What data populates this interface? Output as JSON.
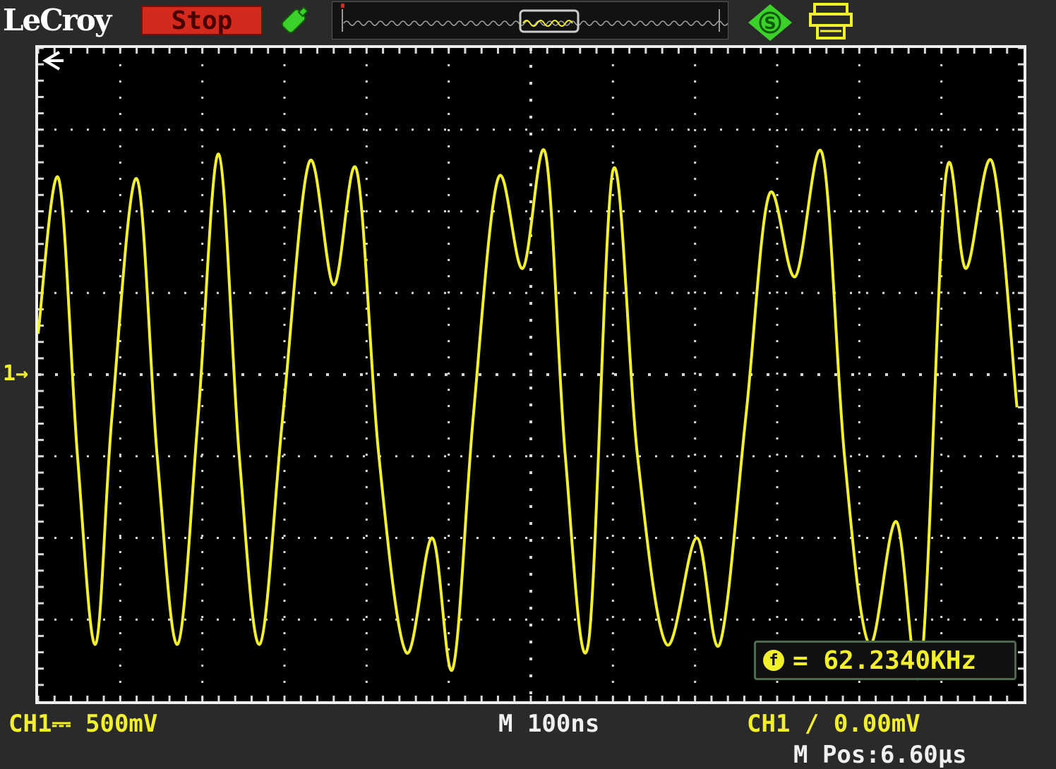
{
  "brand": "LeCroy",
  "run_state": "Stop",
  "channel_marker": "1→",
  "measurement": {
    "value": "= 62.2340KHz",
    "icon_letter": "f"
  },
  "status": {
    "ch1_scale": "CH1⎓ 500mV",
    "timebase": "M 100ns",
    "trigger": "CH1 ∕ 0.00mV",
    "position": "M Pos:6.60µs"
  },
  "icons": [
    "probe-icon",
    "s-icon",
    "printer-icon",
    "back-arrow-icon"
  ],
  "colors": {
    "trace": "#f2ef2d",
    "stop": "#d42a1e",
    "grid": "#d8d8d8",
    "green": "#3bd12a"
  },
  "chart_data": {
    "type": "line",
    "title": "",
    "xlabel": "",
    "ylabel": "",
    "x_div": 12,
    "y_div": 8,
    "xlim": [
      0,
      12
    ],
    "ylim": [
      -4,
      4
    ],
    "series": [
      {
        "values_x": [
          0,
          0.25,
          0.48,
          0.7,
          0.9,
          1.2,
          1.45,
          1.7,
          1.95,
          2.2,
          2.45,
          2.7,
          2.98,
          3.3,
          3.6,
          3.88,
          4.15,
          4.48,
          4.8,
          5.05,
          5.3,
          5.6,
          5.9,
          6.18,
          6.42,
          6.7,
          7.0,
          7.3,
          7.65,
          8.02,
          8.3,
          8.62,
          8.9,
          9.22,
          9.55,
          9.82,
          10.12,
          10.45,
          10.75,
          11.05,
          11.3,
          11.62,
          11.92
        ],
        "values_y": [
          0.5,
          2.4,
          -1.0,
          -3.3,
          -0.5,
          2.4,
          -1.0,
          -3.3,
          -0.5,
          2.7,
          -1.0,
          -3.3,
          -0.5,
          2.6,
          1.1,
          2.5,
          -1.0,
          -3.4,
          -2.0,
          -3.6,
          -0.5,
          2.4,
          1.3,
          2.7,
          -1.0,
          -3.3,
          2.5,
          -1.0,
          -3.3,
          -2.0,
          -3.3,
          -0.5,
          2.2,
          1.2,
          2.7,
          -1.0,
          -3.3,
          -1.8,
          -3.6,
          2.4,
          1.3,
          2.6,
          -0.4
        ]
      }
    ]
  }
}
